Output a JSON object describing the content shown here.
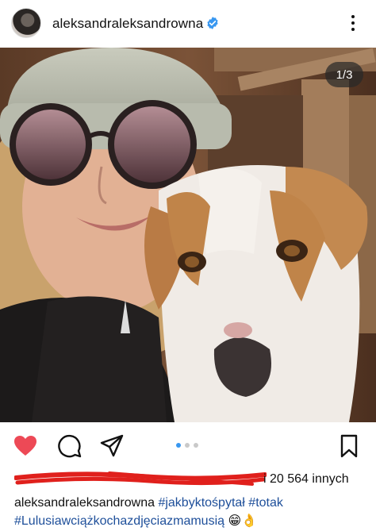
{
  "post": {
    "username": "aleksandraleksandrowna",
    "verified": true,
    "counter": "1/3",
    "likes_suffix": "i 20 564 innych",
    "caption": {
      "user": "aleksandraleksandrowna",
      "tags_line1": [
        "#jakbyktośpytał",
        "#totak"
      ],
      "line2_tag": "#Lulusiawciążkochazdjęciazmamusią",
      "line2_emoji": "😁👌"
    }
  },
  "icons": {
    "verified": "verified-badge-icon",
    "menu": "more-options-icon",
    "like": "heart-icon",
    "comment": "comment-icon",
    "share": "share-icon",
    "save": "bookmark-icon"
  },
  "carousel": {
    "count": 3,
    "active": 0
  },
  "colors": {
    "like": "#ed4956",
    "link": "#1e4f9a",
    "active_dot": "#3897f0",
    "redaction": "#e0201c"
  }
}
